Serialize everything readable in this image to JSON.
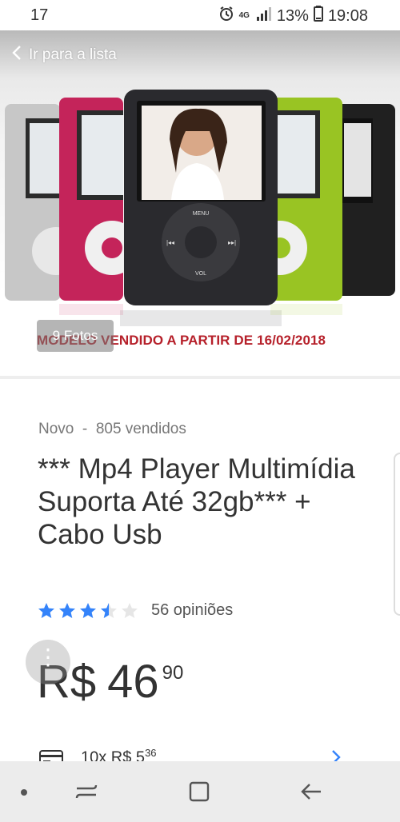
{
  "status_bar": {
    "left_text": "17",
    "network": "4G",
    "battery": "13%",
    "time": "19:08"
  },
  "header": {
    "back_label": "Ir para a lista"
  },
  "gallery": {
    "photo_count_label": "9 Fotos",
    "model_note": "MODELO VENDIDO A PARTIR DE 16/02/2018"
  },
  "product": {
    "condition": "Novo",
    "separator": "-",
    "sold": "805 vendidos",
    "title": "*** Mp4 Player Multimídia Suporta Até 32gb*** + Cabo Usb",
    "rating": 3.5,
    "rating_max": 5,
    "reviews": "56 opiniões",
    "price_currency": "R$",
    "price_integer": "46",
    "price_cents": "90",
    "installments_prefix": "10x R$ 5",
    "installments_cents": "36"
  },
  "colors": {
    "accent": "#3483fa",
    "star_empty": "#e6e6e6",
    "note_red": "#b6202a",
    "text": "#333333"
  },
  "icons": {
    "back": "chevron-left-icon",
    "alarm": "alarm-icon",
    "signal": "signal-icon",
    "battery": "battery-icon",
    "card": "card-icon",
    "more": "more-vertical-icon",
    "chevron": "chevron-right-icon"
  }
}
